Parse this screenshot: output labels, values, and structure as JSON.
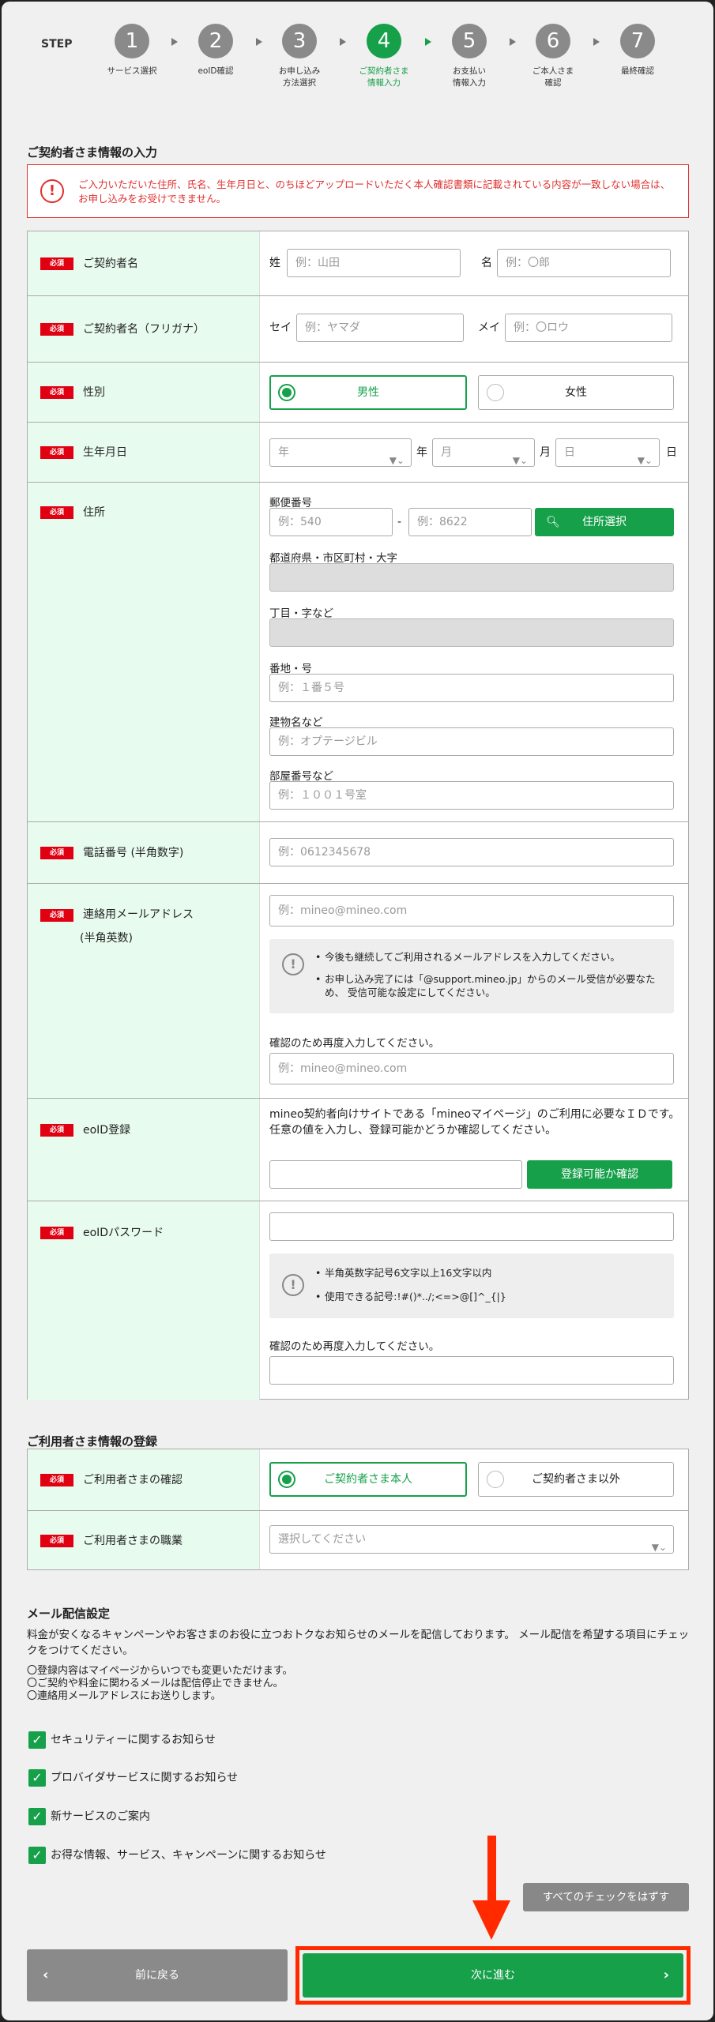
{
  "steps": {
    "heading": "STEP",
    "items": [
      {
        "num": "1",
        "label": "サービス選択"
      },
      {
        "num": "2",
        "label": "eoID確認"
      },
      {
        "num": "3",
        "label": "お申し込み\n方法選択"
      },
      {
        "num": "4",
        "label": "ご契約者さま\n情報入力"
      },
      {
        "num": "5",
        "label": "お支払い\n情報入力"
      },
      {
        "num": "6",
        "label": "ご本人さま\n確認"
      },
      {
        "num": "7",
        "label": "最終確認"
      }
    ],
    "active": "4"
  },
  "contract": {
    "title": "ご契約者さま情報の入力",
    "alert": "ご入力いただいた住所、氏名、生年月日と、のちほどアップロードいただく本人確認書類に記載されている内容が一致しない場合は、お申し込みをお受けできません。",
    "required_badge": "必須",
    "name": {
      "label": "ご契約者名",
      "sei_tag": "姓",
      "sei_ph": "例：山田",
      "mei_tag": "名",
      "mei_ph": "例：〇郎"
    },
    "kana": {
      "label": "ご契約者名（フリガナ）",
      "sei_tag": "セイ",
      "sei_ph": "例：ヤマダ",
      "mei_tag": "メイ",
      "mei_ph": "例：〇ロウ"
    },
    "gender": {
      "label": "性別",
      "male": "男性",
      "female": "女性"
    },
    "birth": {
      "label": "生年月日",
      "year_ph": "年",
      "year_unit": "年",
      "month_ph": "月",
      "month_unit": "月",
      "day_ph": "日",
      "day_unit": "日"
    },
    "address": {
      "label": "住所",
      "zip_label": "郵便番号",
      "zip1_ph": "例：540",
      "zip_dash": "-",
      "zip2_ph": "例：8622",
      "zip_button": "住所選択",
      "pref_label": "都道府県・市区町村・大字",
      "chome_label": "丁目・字など",
      "banchi_label": "番地・号",
      "banchi_ph": "例：１番５号",
      "bldg_label": "建物名など",
      "bldg_ph": "例：オプテージビル",
      "room_label": "部屋番号など",
      "room_ph": "例：１００１号室"
    },
    "phone": {
      "label": "電話番号 (半角数字)",
      "ph": "例：0612345678"
    },
    "email": {
      "label": "連絡用メールアドレス",
      "label2": "(半角英数)",
      "ph": "例：mineo@mineo.com",
      "note1": "今後も継続してご利用されるメールアドレスを入力してください。",
      "note2": "お申し込み完了には「@support.mineo.jp」からのメール受信が必要なため、 受信可能な設定にしてください。",
      "confirm_label": "確認のため再度入力してください。",
      "confirm_ph": "例：mineo@mineo.com"
    },
    "eoid": {
      "label": "eoID登録",
      "desc": "mineo契約者向けサイトである「mineoマイページ」のご利用に必要なＩＤです。\n任意の値を入力し、登録可能かどうか確認してください。",
      "button": "登録可能か確認"
    },
    "password": {
      "label": "eoIDパスワード",
      "note1": "半角英数字記号6文字以上16文字以内",
      "note2": "使用できる記号:!#()*../;<=>@[]^_{|}",
      "confirm_label": "確認のため再度入力してください。"
    }
  },
  "user": {
    "title": "ご利用者さま情報の登録",
    "confirm": {
      "label": "ご利用者さまの確認",
      "self": "ご契約者さま本人",
      "other": "ご契約者さま以外"
    },
    "job": {
      "label": "ご利用者さまの職業",
      "ph": "選択してください"
    }
  },
  "mail": {
    "title": "メール配信設定",
    "desc": "料金が安くなるキャンペーンやお客さまのお役に立つおトクなお知らせのメールを配信しております。 メール配信を希望する項目にチェックをつけてください。",
    "notes": [
      "〇登録内容はマイページからいつでも変更いただけます。",
      "〇ご契約や料金に関わるメールは配信停止できません。",
      "〇連絡用メールアドレスにお送りします。"
    ],
    "checks": [
      "セキュリティーに関するお知らせ",
      "プロバイダサービスに関するお知らせ",
      "新サービスのご案内",
      "お得な情報、サービス、キャンペーンに関するお知らせ"
    ],
    "uncheck_all": "すべてのチェックをはずす"
  },
  "nav": {
    "back": "前に戻る",
    "next": "次に進む"
  },
  "colors": {
    "accent": "#16a04a",
    "required": "#e00012",
    "highlight": "#ff2a00"
  }
}
